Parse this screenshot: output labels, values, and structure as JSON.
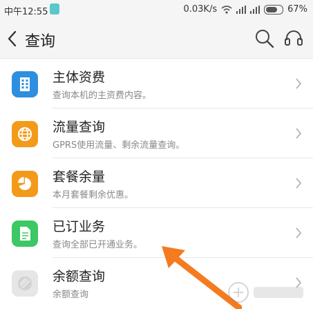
{
  "status_bar": {
    "time": "中午12:55",
    "network_speed": "0.03K/s",
    "battery": "67%"
  },
  "header": {
    "title": "查询"
  },
  "items": [
    {
      "title": "主体资费",
      "subtitle": "查询本机的主资费内容。",
      "icon": "building-icon",
      "color": "#2d8fe0"
    },
    {
      "title": "流量查询",
      "subtitle": "GPRS使用流量、剩余流量查询。",
      "icon": "globe-icon",
      "color": "#f39a1b"
    },
    {
      "title": "套餐余量",
      "subtitle": "本月套餐剩余优惠。",
      "icon": "pie-chart-icon",
      "color": "#f39a1b"
    },
    {
      "title": "已订业务",
      "subtitle": "查询全部已开通业务。",
      "icon": "document-icon",
      "color": "#3cc864"
    },
    {
      "title": "余额查询",
      "subtitle": "余额查询",
      "icon": "wallet-icon",
      "color": "#e6e6e6"
    }
  ],
  "colors": {
    "header_bg": "#f5f5f5",
    "annotation_arrow": "#f47b20"
  }
}
